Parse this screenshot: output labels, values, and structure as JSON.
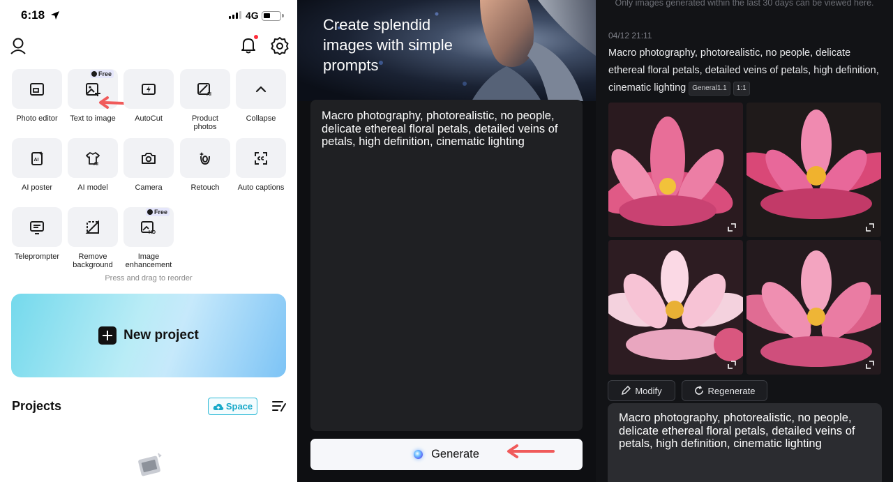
{
  "status_bar": {
    "time": "6:18",
    "network": "4G"
  },
  "home": {
    "tools": [
      {
        "label": "Photo editor",
        "icon": "photo-editor-icon",
        "badge": ""
      },
      {
        "label": "Text to image",
        "icon": "text-to-image-icon",
        "badge": "Free"
      },
      {
        "label": "AutoCut",
        "icon": "autocut-icon",
        "badge": ""
      },
      {
        "label": "Product photos",
        "icon": "product-photos-icon",
        "badge": ""
      },
      {
        "label": "Collapse",
        "icon": "chevron-up-icon",
        "badge": ""
      },
      {
        "label": "AI poster",
        "icon": "ai-poster-icon",
        "badge": ""
      },
      {
        "label": "AI model",
        "icon": "ai-model-icon",
        "badge": ""
      },
      {
        "label": "Camera",
        "icon": "camera-icon",
        "badge": ""
      },
      {
        "label": "Retouch",
        "icon": "retouch-icon",
        "badge": ""
      },
      {
        "label": "Auto captions",
        "icon": "auto-captions-icon",
        "badge": ""
      },
      {
        "label": "Teleprompter",
        "icon": "teleprompter-icon",
        "badge": ""
      },
      {
        "label": "Remove background",
        "icon": "remove-background-icon",
        "badge": ""
      },
      {
        "label": "Image enhancement",
        "icon": "image-enhancement-icon",
        "badge": "Free"
      }
    ],
    "reorder_hint": "Press and drag to reorder",
    "new_project_label": "New project",
    "projects_title": "Projects",
    "space_label": "Space"
  },
  "text_to_image": {
    "hero_title": "Create splendid images with simple prompts",
    "prompt": "Macro photography, photorealistic, no people, delicate ethereal floral petals, detailed veins of petals, high definition, cinematic lighting",
    "generate_label": "Generate"
  },
  "results": {
    "retention_note": "Only images generated within the last 30 days can be viewed here.",
    "timestamp": "04/12 21:11",
    "prompt": "Macro photography, photorealistic, no people, delicate ethereal floral petals, detailed veins of petals, high definition, cinematic lighting",
    "model_tag": "General1.1",
    "ratio_tag": "1:1",
    "modify_label": "Modify",
    "regenerate_label": "Regenerate",
    "input_prompt": "Macro photography, photorealistic, no people, delicate ethereal floral petals, detailed veins of petals, high definition, cinematic lighting"
  },
  "colors": {
    "accent_cyan": "#2bb9d6",
    "annotation_red": "#f05a5a",
    "dark_bg": "#121316"
  }
}
